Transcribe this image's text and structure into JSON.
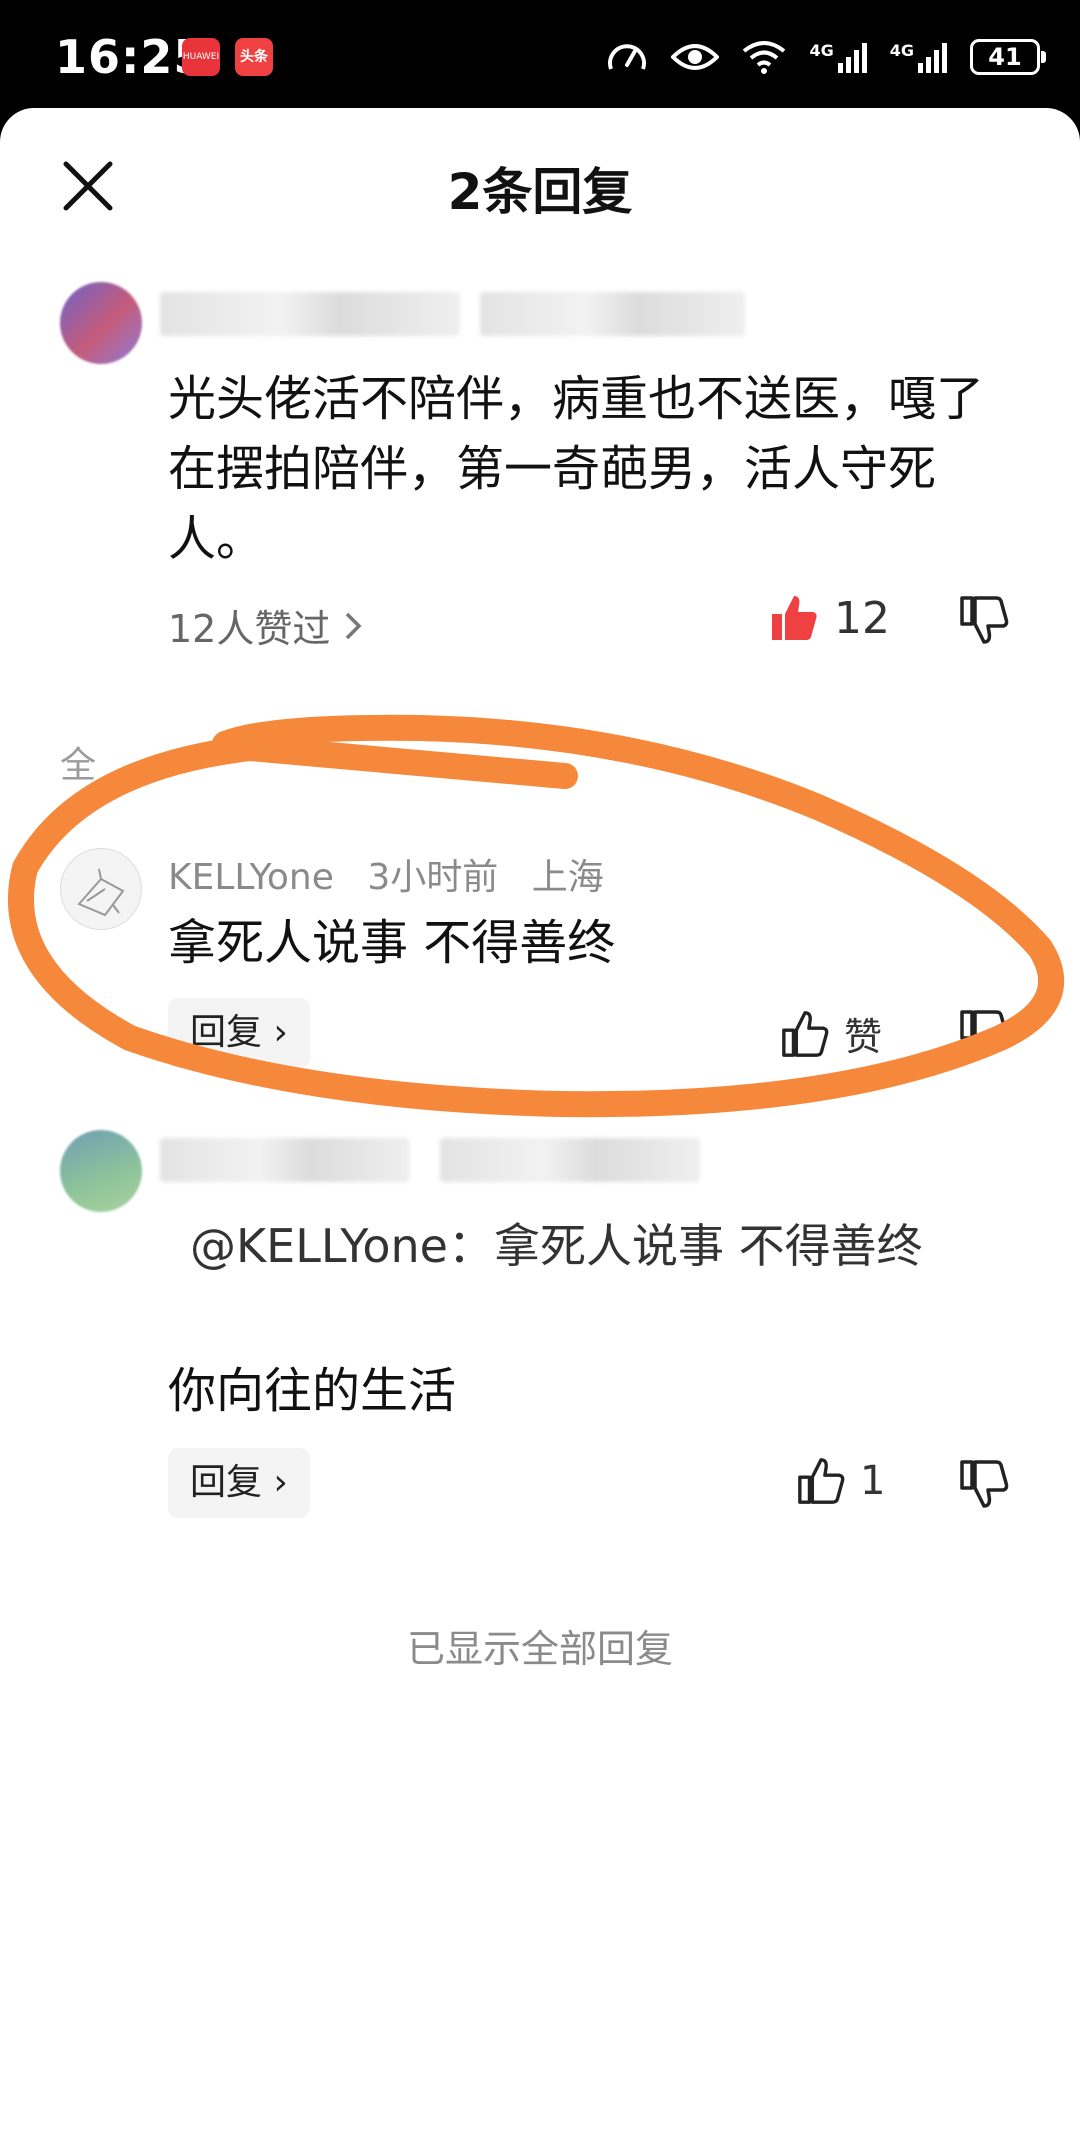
{
  "status_bar": {
    "time": "16:25",
    "app_icons": [
      "HUAWEI",
      "头条"
    ],
    "network": [
      "4G",
      "4G"
    ],
    "battery": "41"
  },
  "header": {
    "title": "2条回复",
    "close_icon": "close-icon"
  },
  "main_comment": {
    "text": "光头佬活不陪伴，病重也不送医，嘎了在摆拍陪伴，第一奇葩男，活人守死人。",
    "likes_summary": "12人赞过",
    "like_count": "12",
    "like_active_color": "#f04142"
  },
  "section_label": "全",
  "replies": [
    {
      "username": "KELLYone",
      "time": "3小时前",
      "location": "上海",
      "text": "拿死人说事 不得善终",
      "reply_label": "回复",
      "like_label": "赞"
    },
    {
      "quote": "@KELLYone：拿死人说事 不得善终",
      "text": "你向往的生活",
      "reply_label": "回复",
      "like_count": "1"
    }
  ],
  "footer": "已显示全部回复",
  "annotation_color": "#f5883a"
}
